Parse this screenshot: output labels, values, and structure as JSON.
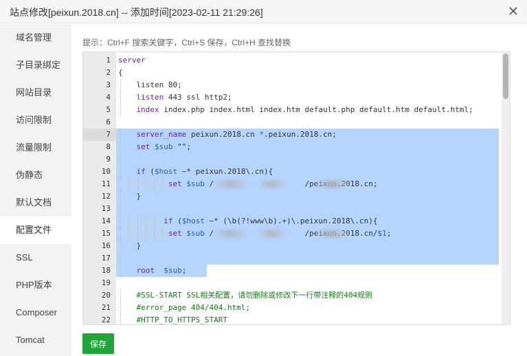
{
  "dialog": {
    "title": "站点修改[peixun.2018.cn] -- 添加时间[2023-02-11 21:29:26]"
  },
  "sidebar": {
    "items": [
      {
        "label": "域名管理"
      },
      {
        "label": "子目录绑定"
      },
      {
        "label": "网站目录"
      },
      {
        "label": "访问限制"
      },
      {
        "label": "流量限制"
      },
      {
        "label": "伪静态"
      },
      {
        "label": "默认文档"
      },
      {
        "label": "配置文件",
        "active": true
      },
      {
        "label": "SSL"
      },
      {
        "label": "PHP版本"
      },
      {
        "label": "Composer"
      },
      {
        "label": "Tomcat"
      }
    ]
  },
  "tip": "提示：Ctrl+F 搜索关键字，Ctrl+S 保存，Ctrl+H 查找替换",
  "editor": {
    "active_line": 7,
    "lines": [
      {
        "n": "1",
        "segs": [
          [
            "kw",
            "server"
          ]
        ]
      },
      {
        "n": "2",
        "segs": [
          [
            "",
            "{"
          ]
        ]
      },
      {
        "n": "3",
        "segs": [
          [
            "",
            "    listen 80;"
          ]
        ]
      },
      {
        "n": "4",
        "segs": [
          [
            "",
            "    "
          ],
          [
            "kw",
            "listen"
          ],
          [
            "",
            " 443 ssl http2;"
          ]
        ]
      },
      {
        "n": "5",
        "segs": [
          [
            "",
            "    "
          ],
          [
            "kw",
            "index"
          ],
          [
            "",
            " index.php index.html index.htm default.php default.htm default.html;"
          ]
        ]
      },
      {
        "n": "6",
        "segs": []
      },
      {
        "n": "7",
        "segs": [
          [
            "",
            "    "
          ],
          [
            "kw",
            "server_name"
          ],
          [
            "",
            " peixun.2018.cn "
          ],
          [
            "var",
            "*"
          ],
          [
            "",
            ".peixun.2018.cn;"
          ]
        ]
      },
      {
        "n": "8",
        "segs": [
          [
            "",
            "    "
          ],
          [
            "kw",
            "set"
          ],
          [
            "",
            " "
          ],
          [
            "var",
            "$sub"
          ],
          [
            "",
            " \"\";"
          ]
        ]
      },
      {
        "n": "9",
        "segs": []
      },
      {
        "n": "10",
        "segs": [
          [
            "",
            "    "
          ],
          [
            "kw",
            "if"
          ],
          [
            "",
            " ("
          ],
          [
            "var",
            "$host"
          ],
          [
            "",
            " ~* peixun.2018\\.cn){"
          ]
        ]
      },
      {
        "n": "11",
        "segs": [
          [
            "",
            "           "
          ],
          [
            "kw",
            "set"
          ],
          [
            "",
            " "
          ],
          [
            "var",
            "$sub"
          ],
          [
            "",
            " /                    /peixun.2018.cn;"
          ]
        ]
      },
      {
        "n": "12",
        "segs": [
          [
            "",
            "    }"
          ]
        ]
      },
      {
        "n": "13",
        "segs": []
      },
      {
        "n": "14",
        "segs": [
          [
            "",
            "          "
          ],
          [
            "kw",
            "if"
          ],
          [
            "",
            " ("
          ],
          [
            "var",
            "$host"
          ],
          [
            "",
            " ~* (\\b(?!www\\b).+)\\.peixun.2018\\.cn){"
          ]
        ]
      },
      {
        "n": "15",
        "segs": [
          [
            "",
            "           "
          ],
          [
            "kw",
            "set"
          ],
          [
            "",
            " "
          ],
          [
            "var",
            "$sub"
          ],
          [
            "",
            " /                    /peixun.2018.cn/"
          ],
          [
            "var",
            "$1"
          ],
          [
            "",
            ";"
          ]
        ]
      },
      {
        "n": "16",
        "segs": [
          [
            "",
            "    }"
          ]
        ]
      },
      {
        "n": "17",
        "segs": []
      },
      {
        "n": "18",
        "segs": [
          [
            "",
            "    "
          ],
          [
            "kw",
            "root"
          ],
          [
            "",
            "  "
          ],
          [
            "var",
            "$sub"
          ],
          [
            "",
            ";"
          ]
        ]
      },
      {
        "n": "19",
        "segs": []
      },
      {
        "n": "20",
        "segs": [
          [
            "cm",
            "    #SSL-START SSL相关配置，请勿删除或修改下一行带注释的404规则"
          ]
        ]
      },
      {
        "n": "21",
        "segs": [
          [
            "cm",
            "    #error_page 404/404.html;"
          ]
        ]
      },
      {
        "n": "22",
        "segs": [
          [
            "cm",
            "    #HTTP_TO_HTTPS_START"
          ]
        ]
      }
    ]
  },
  "save_label": "保存",
  "colors": {
    "accent": "#20a53a",
    "selection": "#b5d5ff",
    "keyword": "#6a1fb0",
    "variable": "#2a5db0",
    "comment": "#1a7a1a"
  }
}
